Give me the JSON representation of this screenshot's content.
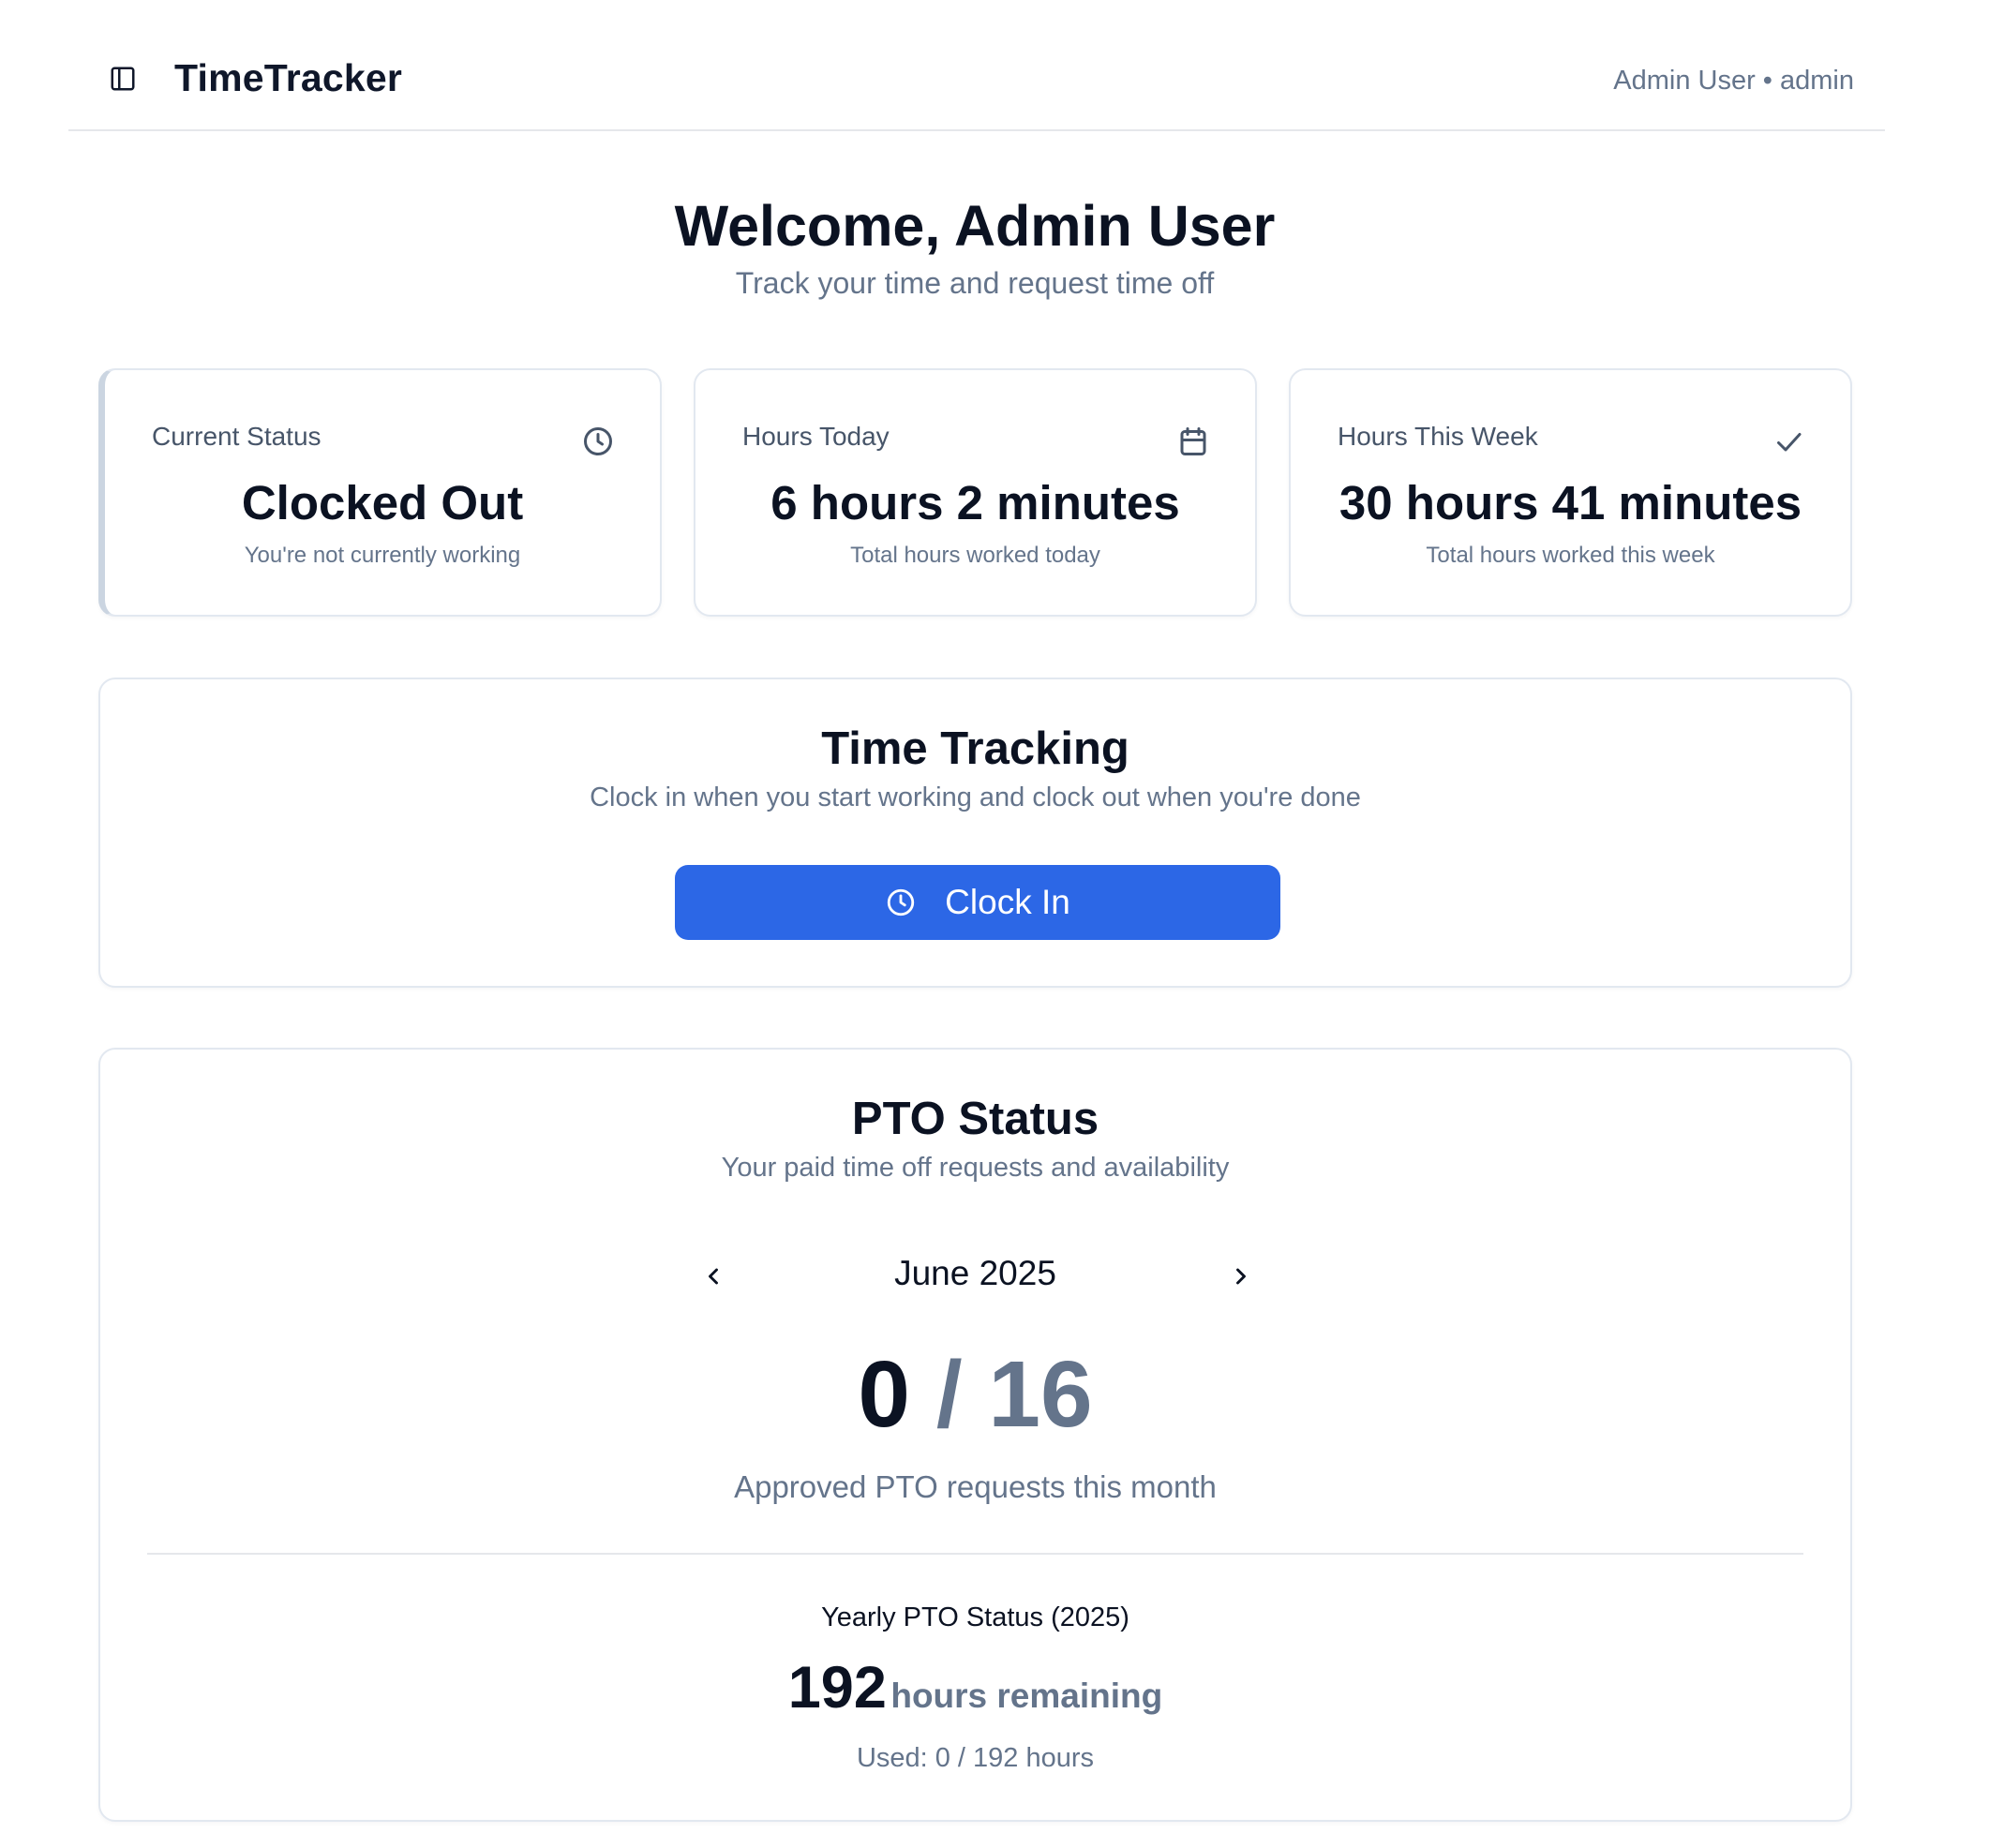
{
  "header": {
    "app_title": "TimeTracker",
    "user_info": "Admin User • admin"
  },
  "welcome": {
    "title": "Welcome, Admin User",
    "subtitle": "Track your time and request time off"
  },
  "stats": [
    {
      "label": "Current Status",
      "value": "Clocked Out",
      "description": "You're not currently working",
      "icon": "clock-icon"
    },
    {
      "label": "Hours Today",
      "value": "6 hours 2 minutes",
      "description": "Total hours worked today",
      "icon": "calendar-icon"
    },
    {
      "label": "Hours This Week",
      "value": "30 hours 41 minutes",
      "description": "Total hours worked this week",
      "icon": "check-icon"
    }
  ],
  "time_tracking": {
    "title": "Time Tracking",
    "subtitle": "Clock in when you start working and clock out when you're done",
    "button_label": "Clock In",
    "button_color": "#2c67e6"
  },
  "pto": {
    "title": "PTO Status",
    "subtitle": "Your paid time off requests and availability",
    "month": "June 2025",
    "approved_count": "0",
    "separator_total": "/ 16",
    "caption": "Approved PTO requests this month",
    "yearly_title": "Yearly PTO Status (2025)",
    "yearly_remaining_value": "192",
    "yearly_remaining_unit": "hours remaining",
    "yearly_used": "Used: 0 / 192 hours"
  },
  "colors": {
    "text_primary": "#0b1222",
    "text_muted": "#64748b",
    "border": "#e2e8f0",
    "accent_blue": "#2c67e6"
  }
}
